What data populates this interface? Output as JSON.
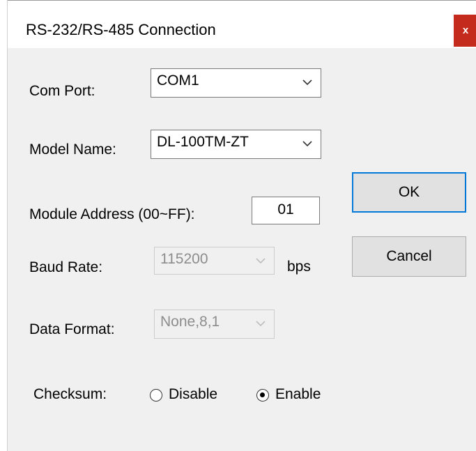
{
  "dialog": {
    "title": "RS-232/RS-485 Connection",
    "close_label": "x"
  },
  "com_port": {
    "label": "Com Port:",
    "value": "COM1",
    "enabled": true
  },
  "model_name": {
    "label": "Model Name:",
    "value": "DL-100TM-ZT",
    "enabled": true
  },
  "module_address": {
    "label": "Module Address (00~FF):",
    "value": "01"
  },
  "baud_rate": {
    "label": "Baud Rate:",
    "value": "115200",
    "unit": "bps",
    "enabled": false
  },
  "data_format": {
    "label": "Data Format:",
    "value": "None,8,1",
    "enabled": false
  },
  "checksum": {
    "label": "Checksum:",
    "options": [
      {
        "label": "Disable",
        "selected": false
      },
      {
        "label": "Enable",
        "selected": true
      }
    ]
  },
  "buttons": {
    "ok_label": "OK",
    "cancel_label": "Cancel"
  },
  "colors": {
    "close_bg": "#c42b1c",
    "default_button_border": "#0078d7",
    "dialog_bg": "#f0f0f0"
  }
}
